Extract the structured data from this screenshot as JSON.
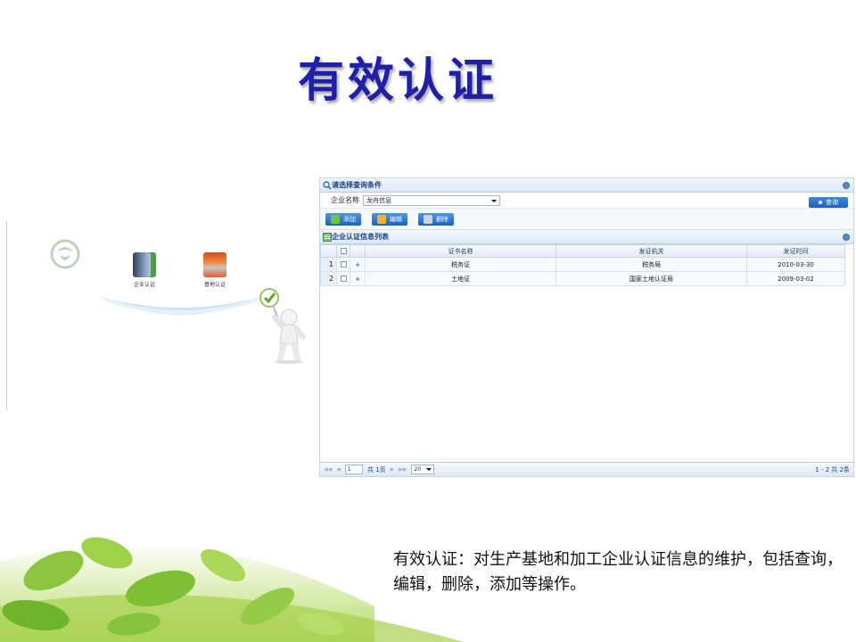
{
  "slide": {
    "title": "有效认证",
    "description": "有效认证：对生产基地和加工企业认证信息的维护，包括查询，编辑，删除，添加等操作。"
  },
  "launcher": {
    "items": [
      {
        "label": "企业认证",
        "icon": "building-icon"
      },
      {
        "label": "基地认证",
        "icon": "books-icon"
      }
    ]
  },
  "app": {
    "query_panel": {
      "title": "请选择查询条件"
    },
    "filter": {
      "label": "企业名称",
      "value": "龙舟信息"
    },
    "query_button": "查询",
    "toolbar": {
      "add": "添加",
      "edit": "编辑",
      "delete": "删除"
    },
    "list_panel": {
      "title": "企业认证信息列表"
    },
    "grid": {
      "columns": [
        "证书名称",
        "发证机关",
        "发证时间"
      ],
      "rows": [
        {
          "no": "1",
          "expand": "+",
          "name": "税务证",
          "issuer": "税务局",
          "date": "2010-03-30"
        },
        {
          "no": "2",
          "expand": "+",
          "name": "土地证",
          "issuer": "国家土地认证局",
          "date": "2009-03-02"
        }
      ]
    },
    "pager": {
      "page": "1",
      "total_pages": "共 1页",
      "page_size": "20",
      "info": "1 - 2   共 2条"
    }
  },
  "colors": {
    "title": "#1f1fa8",
    "accent": "#1c5fb8",
    "leaf": "#8cc63f"
  }
}
